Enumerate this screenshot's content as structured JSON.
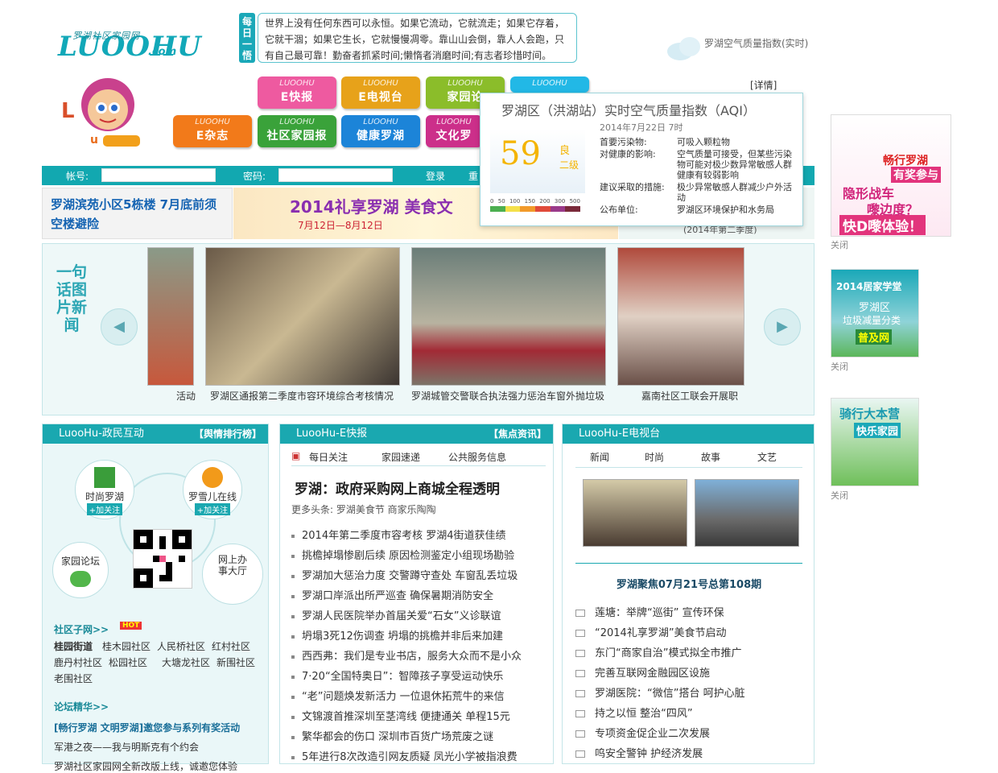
{
  "logo": {
    "cn": "罗湖社区家园网",
    "en": "LUOOHU",
    ".com": ".com",
    "com": ".com"
  },
  "daily": {
    "tag": "每日一悟",
    "text": "世界上没有任何东西可以永恒。如果它流动，它就流走；如果它存着，它就干涸；如果它生长，它就慢慢凋零。靠山山会倒，靠人人会跑，只有自己最可靠！勤奋者抓紧时间;懒惰者消磨时间;有志者珍惜时间。"
  },
  "aqi": {
    "top_label": "罗湖空气质量指数(实时)",
    "detail_link": "[详情]",
    "popup_title": "罗湖区（洪湖站）实时空气质量指数（AQI）",
    "date": "2014年7月22日  7时",
    "value": "59",
    "level": "良",
    "grade": "二级",
    "scale": [
      "0",
      "50",
      "100",
      "150",
      "200",
      "300",
      "500"
    ],
    "rows": [
      {
        "k": "首要污染物:",
        "v": "可吸入颗粒物"
      },
      {
        "k": "对健康的影响:",
        "v": "空气质量可接受，但某些污染物可能对极少数异常敏感人群健康有较弱影响"
      },
      {
        "k": "建议采取的措施:",
        "v": "极少异常敏感人群减少户外活动"
      },
      {
        "k": "公布单位:",
        "v": "罗湖区环境保护和水务局"
      }
    ],
    "colors": {
      "good": "#f4b400",
      "scale_green": "#4caf50"
    }
  },
  "nav": {
    "brand": "LUOOHU",
    "tiles": [
      {
        "label": "E快报",
        "color": "#ee5aa0"
      },
      {
        "label": "E电视台",
        "color": "#e7a21a"
      },
      {
        "label": "家园论",
        "color": "#8bbd2a"
      },
      {
        "label": "",
        "color": "#22b8e6"
      },
      {
        "label": "E杂志",
        "color": "#f27a1a"
      },
      {
        "label": "社区家园报",
        "color": "#3aa23a"
      },
      {
        "label": "健康罗湖",
        "color": "#1c84d8"
      },
      {
        "label": "文化罗",
        "color": "#cc2f8a"
      }
    ]
  },
  "login": {
    "account": "帐号:",
    "password": "密码:",
    "login_btn": "登录",
    "reg": "重"
  },
  "banners": {
    "b1": "罗湖滨苑小区5栋楼 7月底前须空楼避险",
    "b2": "2014礼享罗湖 美食文",
    "b2_date": "7月12日—8月12日",
    "b3": "(2014年第二季度)"
  },
  "carousel": {
    "side_title": "一句话图片新闻",
    "captions": [
      "活动",
      "罗湖区通报第二季度市容环境综合考核情况",
      "罗湖城管交警联合执法强力惩治车窗外抛垃圾",
      "嘉南社区工联会开展职"
    ]
  },
  "panel1": {
    "title": "LuooHu-政民互动",
    "more": "【舆情排行榜】",
    "circles": [
      {
        "label": "时尚罗湖",
        "follow": "+加关注"
      },
      {
        "label": "罗雪儿在线",
        "follow": "+加关注"
      },
      {
        "label": "家园论坛",
        "follow": ""
      },
      {
        "label": "网上办事大厅",
        "follow": ""
      }
    ],
    "sub_title": "社区子网>>",
    "hot": "HOT",
    "communities": [
      "桂园街道",
      "桂木园社区",
      "人民桥社区",
      "红村社区",
      "鹿丹村社区",
      "松园社区",
      "大塘龙社区",
      "新围社区",
      "老围社区"
    ],
    "forum_title": "论坛精华>>",
    "forum_items": [
      "[畅行罗湖 文明罗湖]邀您参与系列有奖活动",
      "军港之夜——我与明斯克有个约会",
      "罗湖社区家园网全新改版上线，诚邀您体验"
    ]
  },
  "panel2": {
    "title": "LuooHu-E快报",
    "more": "【焦点资讯】",
    "tabs": [
      "每日关注",
      "家园速递",
      "公共服务信息"
    ],
    "headline": "罗湖：政府采购网上商城全程透明",
    "more_heads": "更多头条: 罗湖美食节  商家乐陶陶",
    "items": [
      "2014年第二季度市容考核  罗湖4街道获佳绩",
      "挑檐掉塌惨剧后续  原因检测鉴定小组现场勘验",
      "罗湖加大惩治力度  交警蹲守查处  车窗乱丢垃圾",
      "罗湖口岸派出所严巡查  确保暑期消防安全",
      "罗湖人民医院举办首届关爱“石女”义诊联谊",
      "坍塌3死12伤调查  坍塌的挑檐并非后来加建",
      "西西弗：我们是专业书店，服务大众而不是小众",
      "7·20“全国特奥日”：智障孩子享受运动快乐",
      "“老”问题焕发新活力  一位退休拓荒牛的来信",
      "文锦渡首推深圳至茎湾线  便捷通关  单程15元",
      "繁华都会的伤口  深圳市百货广场荒废之谜",
      "5年进行8次改造引网友质疑  凤光小学被指浪费"
    ]
  },
  "panel3": {
    "title": "LuooHu-E电视台",
    "tabs": [
      "新闻",
      "时尚",
      "故事",
      "文艺"
    ],
    "episode": "罗湖聚焦07月21号总第108期",
    "items": [
      "莲塘：举牌“巡街”  宣传环保",
      "“2014礼享罗湖”美食节启动",
      "东门“商家自治”模式拟全市推广",
      "完善互联网金融园区设施",
      "罗湖医院：“微信”搭台  呵护心脏",
      "持之以恒  整治“四风”",
      "专项资金促企业二次发展",
      "呜安全警钟  护经济发展"
    ]
  },
  "right_ads": {
    "ad1": [
      "畅行罗湖",
      "有奖参与",
      "隐形战车",
      "嚟边度？",
      "快D嚟体验！"
    ],
    "ad2": [
      "2014居家学堂",
      "罗湖区",
      "垃圾减量分类",
      "普及网"
    ],
    "ad3": [
      "骑行大本营",
      "快乐家园"
    ],
    "close": "关闭"
  }
}
